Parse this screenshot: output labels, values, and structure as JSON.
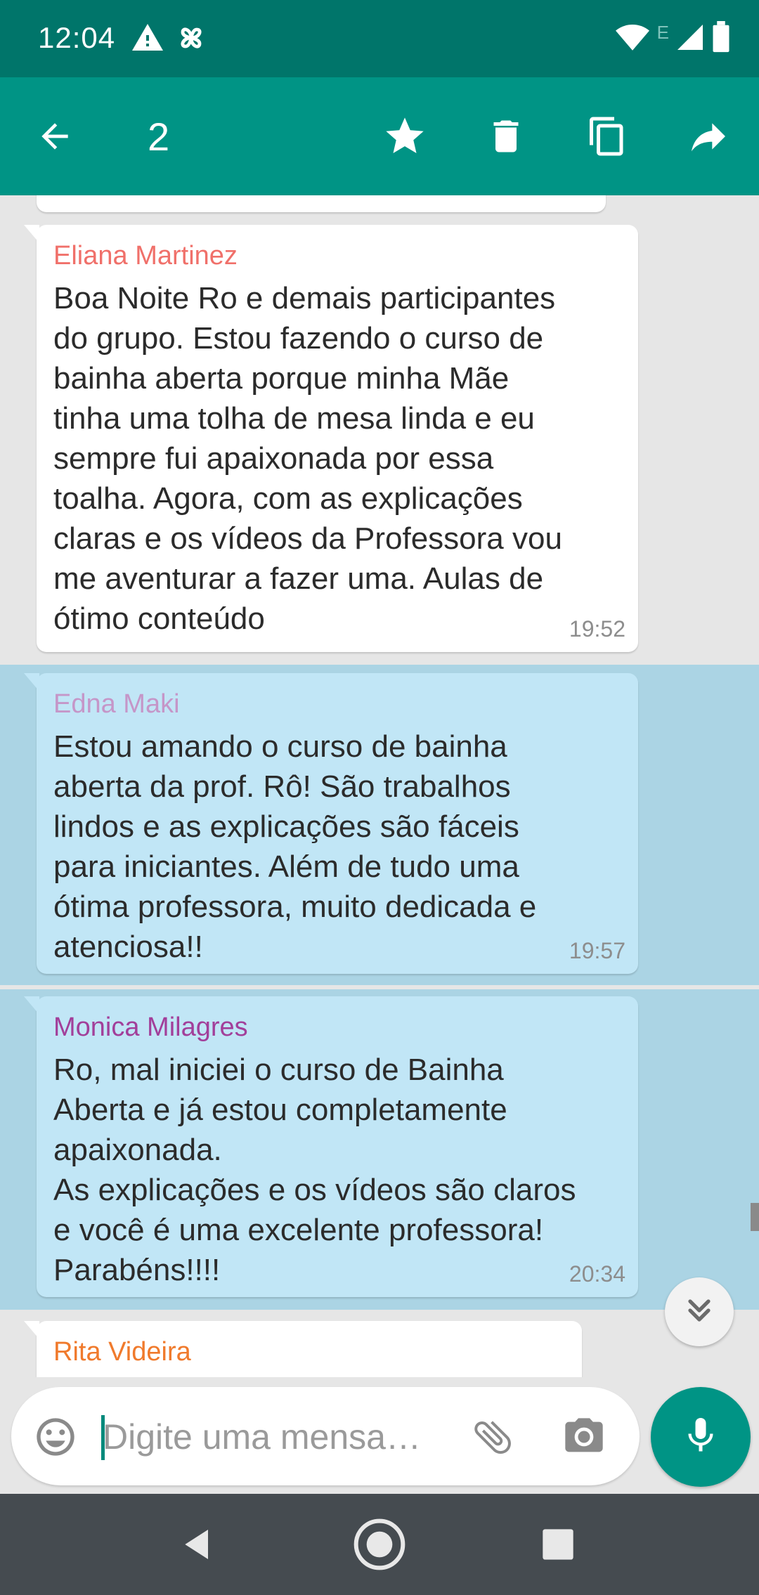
{
  "status_bar": {
    "time": "12:04",
    "network_label": "E",
    "icons": [
      "warning-icon",
      "pinwheel-icon",
      "wifi-icon",
      "signal-icon",
      "battery-icon"
    ]
  },
  "action_bar": {
    "selected_count": "2",
    "icons": [
      "back-arrow-icon",
      "star-icon",
      "delete-icon",
      "copy-icon",
      "forward-icon"
    ]
  },
  "messages": [
    {
      "sender": "Eliana Martinez",
      "sender_color": "#f0706a",
      "text": "Boa Noite Ro e demais participantes\ndo grupo. Estou fazendo o curso de\nbainha aberta porque minha Mãe\ntinha uma tolha de mesa linda e eu\nsempre fui apaixonada por essa\ntoalha.  Agora, com as explicações\nclaras e os vídeos da Professora vou\nme aventurar a fazer uma. Aulas de\nótimo conteúdo",
      "time": "19:52",
      "selected": false
    },
    {
      "sender": "Edna Maki",
      "sender_color": "#c596c8",
      "text": "Estou amando o curso de bainha\naberta da prof. Rô!  São trabalhos\nlindos e as explicações são fáceis\npara iniciantes. Além de tudo uma\nótima professora, muito dedicada e\natenciosa!!",
      "time": "19:57",
      "selected": true
    },
    {
      "sender": "Monica Milagres",
      "sender_color": "#a23f9a",
      "text": "Ro, mal iniciei o curso de Bainha\nAberta e já estou completamente\napaixonada.\nAs explicações e os vídeos são claros\ne você é uma excelente professora!\nParabéns!!!!",
      "time": "20:34",
      "selected": true
    },
    {
      "sender": "Rita Videira",
      "sender_color": "#f07a2c",
      "text": "",
      "time": "",
      "selected": false
    }
  ],
  "input": {
    "placeholder": "Digite uma mensa…"
  },
  "colors": {
    "primary": "#009485",
    "primary_dark": "#00756a",
    "selected_row": "#abd4e4",
    "selected_bubble": "#c1e6f6"
  }
}
